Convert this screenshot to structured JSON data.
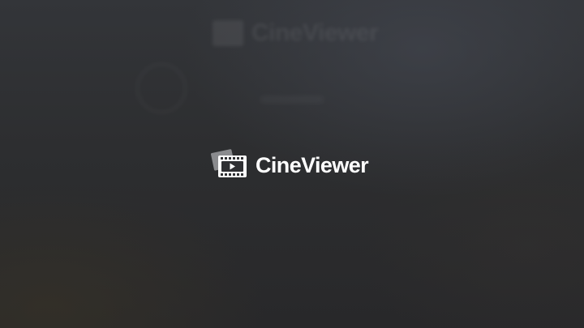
{
  "app": {
    "name": "CineViewer",
    "logo_icon": "film-strip-play-icon"
  },
  "colors": {
    "background": "#2d2e30",
    "logo_text": "#ffffff",
    "icon_back_card": "#8a8b8e"
  }
}
